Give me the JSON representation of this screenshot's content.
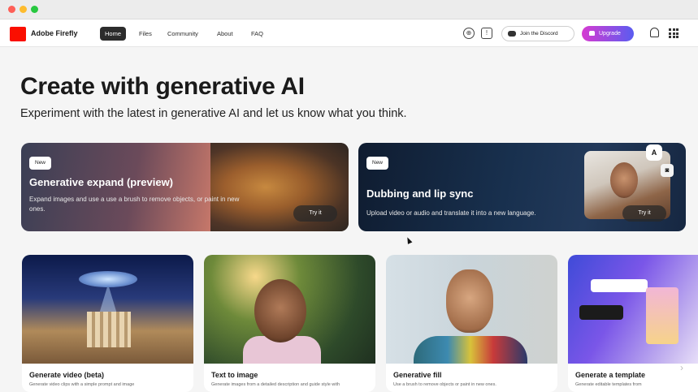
{
  "nav": {
    "brand": "Adobe Firefly",
    "links": [
      "Home",
      "Files",
      "Community",
      "About",
      "FAQ"
    ],
    "discord_label": "Join the Discord",
    "upgrade_label": "Upgrade"
  },
  "hero": {
    "title": "Create with generative AI",
    "subtitle": "Experiment with the latest in generative AI and let us know what you think."
  },
  "features": [
    {
      "badge": "New",
      "title": "Generative expand (preview)",
      "description": "Expand images and use a use a brush to remove objects, or paint in new ones.",
      "button": "Try it"
    },
    {
      "badge": "New",
      "title": "Dubbing and lip sync",
      "description": "Upload video or audio and translate it into a new language.",
      "button": "Try it",
      "overlay_letter": "A"
    }
  ],
  "cards": [
    {
      "title": "Generate video (beta)",
      "description": "Generate video clips with a simple prompt and image"
    },
    {
      "title": "Text to image",
      "description": "Generate images from a detailed description and guide style with"
    },
    {
      "title": "Generative fill",
      "description": "Use a brush to remove objects or paint in new ones."
    },
    {
      "title": "Generate a template",
      "description": "Generate editable templates from"
    }
  ],
  "colors": {
    "brand_red": "#fa0f00",
    "upgrade_gradient_start": "#d63bd1",
    "upgrade_gradient_end": "#5a5cf0"
  }
}
